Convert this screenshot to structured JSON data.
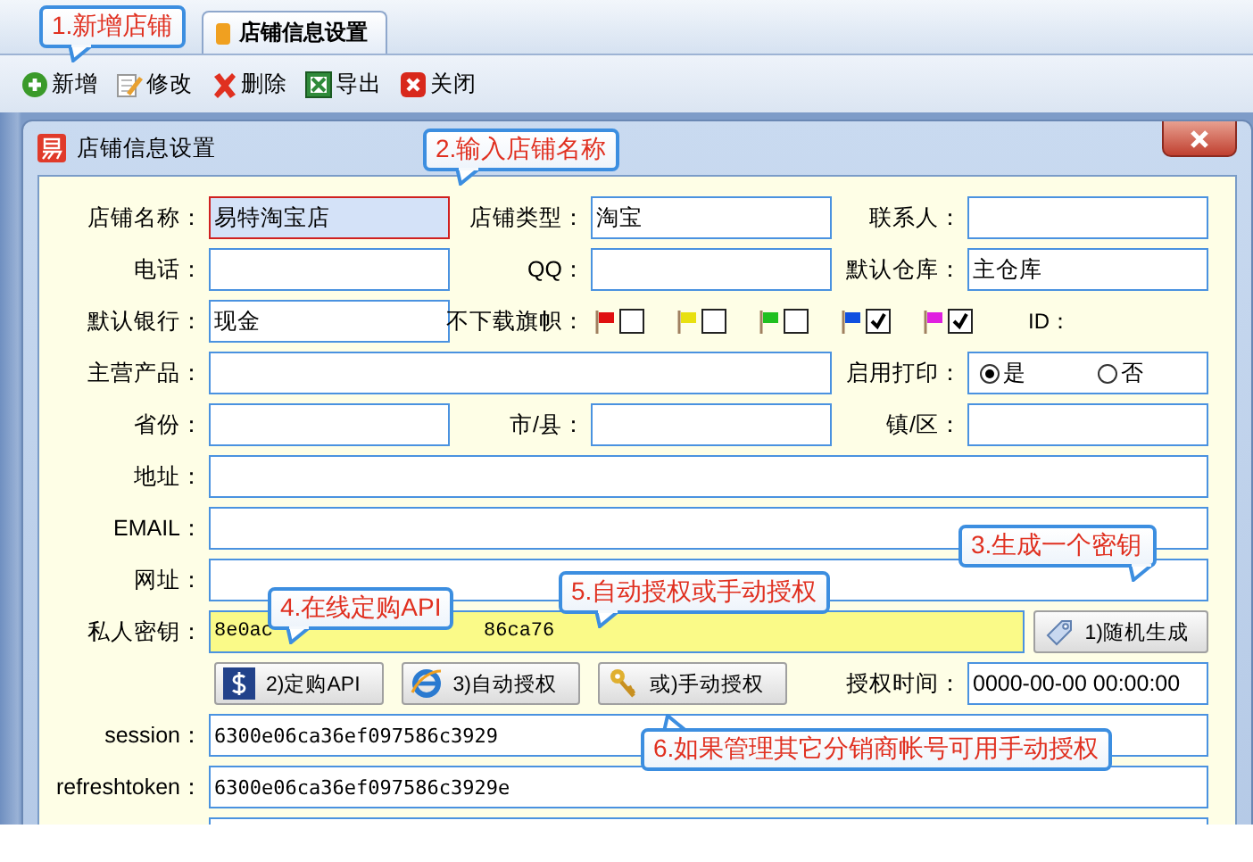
{
  "tabs": [
    {
      "label": "店铺信息设置",
      "selected": true
    }
  ],
  "toolbar": [
    {
      "label": "新增",
      "kind": "add"
    },
    {
      "label": "修改",
      "kind": "edit"
    },
    {
      "label": "删除",
      "kind": "delete"
    },
    {
      "label": "导出",
      "kind": "export"
    },
    {
      "label": "关闭",
      "kind": "close"
    }
  ],
  "dialog": {
    "title": "店铺信息设置",
    "rows": [
      {
        "cells": [
          {
            "label": "店铺名称：",
            "kind": "field",
            "value": "易特淘宝店",
            "focused": true
          },
          {
            "label": "店铺类型：",
            "kind": "field",
            "value": "淘宝",
            "focused": false
          },
          {
            "label": "联系人：",
            "kind": "field",
            "focused": false
          }
        ]
      },
      {
        "cells": [
          {
            "label": "电话：",
            "kind": "field",
            "focused": false
          },
          {
            "label": "QQ：",
            "kind": "field",
            "focused": false
          },
          {
            "label": "默认仓库：",
            "kind": "field",
            "value": "主仓库",
            "focused": false
          }
        ]
      },
      {
        "cells": [
          {
            "label": "默认银行：",
            "kind": "field",
            "value": "现金",
            "focused": false
          },
          {
            "label": "不下载旗帜：",
            "kind": "flags",
            "flags": [
              {
                "color": "#e01010",
                "checked": false
              },
              {
                "color": "#e8e010",
                "checked": false
              },
              {
                "color": "#20c020",
                "checked": false
              },
              {
                "color": "#1050e0",
                "checked": true
              },
              {
                "color": "#e020e0",
                "checked": true
              }
            ]
          },
          {
            "label": "ID：",
            "kind": "tag"
          }
        ]
      },
      {
        "cells": [
          {
            "label": "主营产品：",
            "kind": "field-wide",
            "focused": false
          },
          {
            "label": "启用打印：",
            "kind": "radio",
            "options": [
              {
                "label": "是",
                "selected": true
              },
              {
                "label": "否",
                "selected": false
              }
            ]
          }
        ]
      },
      {
        "cells": [
          {
            "label": "省份：",
            "kind": "field",
            "focused": false
          },
          {
            "label": "市/县：",
            "kind": "field",
            "focused": false
          },
          {
            "label": "镇/区：",
            "kind": "field",
            "focused": false
          }
        ]
      },
      {
        "cells": [
          {
            "label": "地址：",
            "kind": "field-full",
            "focused": false
          }
        ]
      },
      {
        "cells": [
          {
            "label": "EMAIL：",
            "kind": "field-full",
            "focused": false
          }
        ]
      },
      {
        "cells": [
          {
            "label": "网址：",
            "kind": "field-full",
            "focused": false
          }
        ]
      },
      {
        "cells": [
          {
            "label": "私人密钥：",
            "kind": "key",
            "value_parts": [
              "8e0ac",
              "86ca76"
            ],
            "button": "1)随机生成"
          }
        ]
      },
      {
        "cells": [
          {
            "kind": "buttons",
            "buttons": [
              {
                "label": "2)定购API",
                "kind": "dollar"
              },
              {
                "label": "3)自动授权",
                "kind": "browser"
              },
              {
                "label": "或)手动授权",
                "kind": "keys"
              }
            ]
          },
          {
            "label": "授权时间：",
            "kind": "field",
            "value": "0000-00-00 00:00:00",
            "focused": false
          }
        ]
      },
      {
        "cells": [
          {
            "label": "session：",
            "kind": "field-full",
            "value": "6300e06ca36ef097586c3929",
            "focused": false
          }
        ]
      },
      {
        "cells": [
          {
            "label": "refreshtoken：",
            "kind": "field-full",
            "value": "6300e06ca36ef097586c3929e",
            "focused": false
          }
        ]
      },
      {
        "cells": [
          {
            "kind": "field-full",
            "focused": false
          }
        ]
      }
    ]
  },
  "callouts": [
    "1.新增店铺",
    "2.输入店铺名称",
    "3.生成一个密钥",
    "4.在线定购API",
    "5.自动授权或手动授权",
    "6.如果管理其它分销商帐号可用手动授权"
  ]
}
